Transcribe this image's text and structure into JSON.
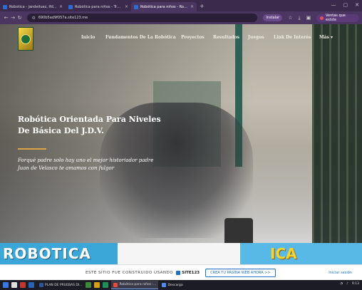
{
  "browser": {
    "tabs": [
      {
        "label": "Robotica - jandeiluez, Ifdhgv...",
        "active": false,
        "color": "#2e6bd1"
      },
      {
        "label": "Robótica para niños - Trabajo...",
        "active": false,
        "color": "#2e6bd1"
      },
      {
        "label": "Robótica para niños - Robótica...",
        "active": true,
        "color": "#2e6bd1"
      }
    ],
    "new_tab": "+",
    "url": "690b5ad9f057a.site123.me",
    "install_label": "Instalar",
    "profile_label": "Ventas que existe"
  },
  "site": {
    "nav": [
      "Inicio",
      "Fundamentos De La Robótica",
      "Proyectos",
      "Resultados",
      "Juegos",
      "Link De Interés",
      "Más ▾"
    ],
    "headline_line1": "Robótica Orientada Para Niveles",
    "headline_line2": "De Básica Del J.D.V.",
    "subtext_line1": "Forqué padre solo hay uno el mejor historiador padre",
    "subtext_line2": "Juan de Velasco te amamos con fulgor",
    "banner_left_text": "ROBOTICA",
    "banner_right_text": "ICA"
  },
  "site123": {
    "text": "ESTE SITIO FUE CONSTRUIDO USANDO",
    "brand": "SITE123",
    "cta": "CREA TU PÁGINA WEB AHORA >>",
    "link": "Iniciar sesión"
  },
  "taskbar": {
    "items": [
      "PLAN DE PRUEBAS DI...",
      "Robótica para niños -...",
      "Descarga"
    ],
    "tray_time": "9:13"
  }
}
